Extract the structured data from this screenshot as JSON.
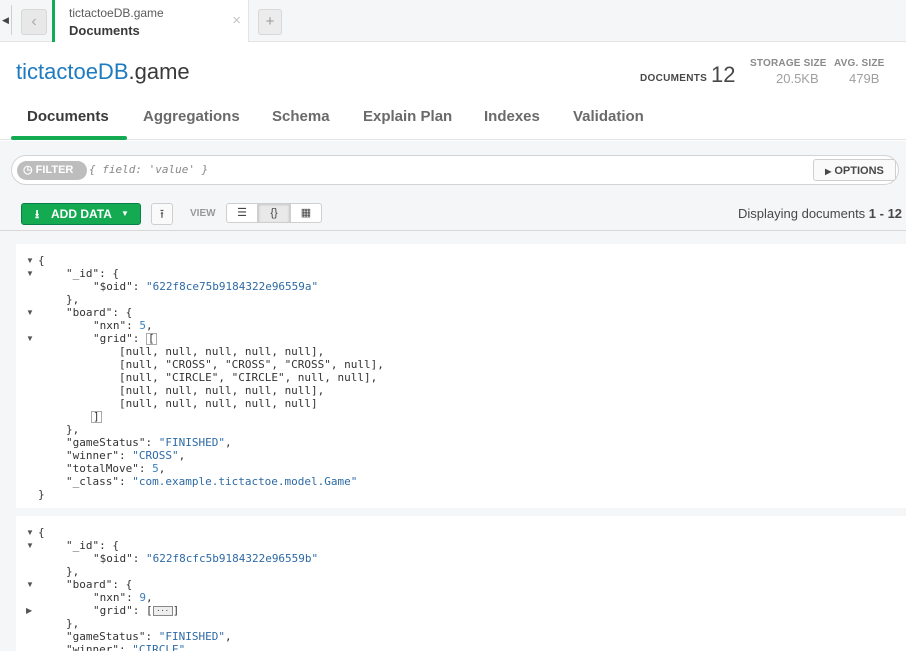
{
  "tab": {
    "db": "tictactoeDB.game",
    "title": "Documents",
    "close": "×",
    "add": "+"
  },
  "header": {
    "db": "tictactoeDB",
    "coll": ".game",
    "documents_label": "DOCUMENTS",
    "documents_value": "12",
    "storage_label": "STORAGE SIZE",
    "storage_value": "20.5KB",
    "avg_label": "AVG. SIZE",
    "avg_value": "479B"
  },
  "nav": {
    "items": [
      "Documents",
      "Aggregations",
      "Schema",
      "Explain Plan",
      "Indexes",
      "Validation"
    ]
  },
  "filter": {
    "pill": "FILTER",
    "placeholder": "{ field: 'value' }",
    "options": "OPTIONS"
  },
  "toolbar": {
    "add_data": "ADD DATA",
    "view_label": "VIEW",
    "display_prefix": "Displaying documents ",
    "display_range": "1 - 12"
  },
  "documents": [
    {
      "id": "\"622f8ce75b9184322e96559a\"",
      "nxn": "5",
      "grid_rows": [
        "[null, null, null, null, null],",
        "[null, \"CROSS\", \"CROSS\", \"CROSS\", null],",
        "[null, \"CIRCLE\", \"CIRCLE\", null, null],",
        "[null, null, null, null, null],",
        "[null, null, null, null, null]"
      ],
      "gameStatus": "\"FINISHED\"",
      "winner": "\"CROSS\"",
      "totalMove": "5",
      "_class": "\"com.example.tictactoe.model.Game\""
    },
    {
      "id": "\"622f8cfc5b9184322e96559b\"",
      "nxn": "9",
      "gameStatus": "\"FINISHED\"",
      "winner": "\"CIRCLE\""
    }
  ]
}
